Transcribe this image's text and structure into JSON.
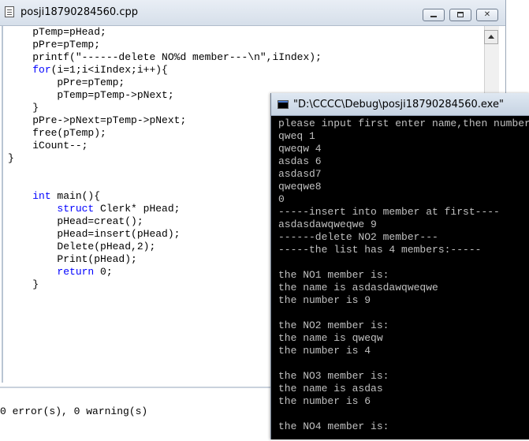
{
  "editor": {
    "title": "posji18790284560.cpp",
    "code_lines": [
      {
        "indent": "    ",
        "parts": [
          {
            "t": "pTemp=pHead;"
          }
        ]
      },
      {
        "indent": "    ",
        "parts": [
          {
            "t": "pPre=pTemp;"
          }
        ]
      },
      {
        "indent": "    ",
        "parts": [
          {
            "t": "printf(\"------delete NO%d member---\\n\",iIndex);"
          }
        ]
      },
      {
        "indent": "    ",
        "parts": [
          {
            "t": "for",
            "kw": true
          },
          {
            "t": "(i=1;i<iIndex;i++){"
          }
        ]
      },
      {
        "indent": "        ",
        "parts": [
          {
            "t": "pPre=pTemp;"
          }
        ]
      },
      {
        "indent": "        ",
        "parts": [
          {
            "t": "pTemp=pTemp->pNext;"
          }
        ]
      },
      {
        "indent": "    ",
        "parts": [
          {
            "t": "}"
          }
        ]
      },
      {
        "indent": "    ",
        "parts": [
          {
            "t": "pPre->pNext=pTemp->pNext;"
          }
        ]
      },
      {
        "indent": "    ",
        "parts": [
          {
            "t": "free(pTemp);"
          }
        ]
      },
      {
        "indent": "    ",
        "parts": [
          {
            "t": "iCount--;"
          }
        ]
      },
      {
        "indent": "",
        "parts": [
          {
            "t": "}"
          }
        ]
      },
      {
        "indent": "",
        "parts": [
          {
            "t": ""
          }
        ]
      },
      {
        "indent": "",
        "parts": [
          {
            "t": ""
          }
        ]
      },
      {
        "indent": "    ",
        "parts": [
          {
            "t": "int",
            "kw": true
          },
          {
            "t": " main(){"
          }
        ]
      },
      {
        "indent": "        ",
        "parts": [
          {
            "t": "struct",
            "kw": true
          },
          {
            "t": " Clerk* pHead;"
          }
        ]
      },
      {
        "indent": "        ",
        "parts": [
          {
            "t": "pHead=creat();"
          }
        ]
      },
      {
        "indent": "        ",
        "parts": [
          {
            "t": "pHead=insert(pHead);"
          }
        ]
      },
      {
        "indent": "        ",
        "parts": [
          {
            "t": "Delete(pHead,2);"
          }
        ]
      },
      {
        "indent": "        ",
        "parts": [
          {
            "t": "Print(pHead);"
          }
        ]
      },
      {
        "indent": "        ",
        "parts": [
          {
            "t": "return",
            "kw": true
          },
          {
            "t": " 0;"
          }
        ]
      },
      {
        "indent": "    ",
        "parts": [
          {
            "t": "}"
          }
        ]
      }
    ],
    "keyword_color": "#0000ff"
  },
  "output": {
    "text": "0 error(s), 0 warning(s)"
  },
  "console": {
    "title": "\"D:\\CCCC\\Debug\\posji18790284560.exe\"",
    "lines": [
      "please input first enter name,then number",
      "qweq 1",
      "qweqw 4",
      "asdas 6",
      "asdasd7",
      "qweqwe8",
      "0",
      "-----insert into member at first----",
      "asdasdawqweqwe 9",
      "------delete NO2 member---",
      "-----the list has 4 members:-----",
      "",
      "the NO1 member is:",
      "the name is asdasdawqweqwe",
      "the number is 9",
      "",
      "the NO2 member is:",
      "the name is qweqw",
      "the number is 4",
      "",
      "the NO3 member is:",
      "the name is asdas",
      "the number is 6",
      "",
      "the NO4 member is:"
    ]
  }
}
